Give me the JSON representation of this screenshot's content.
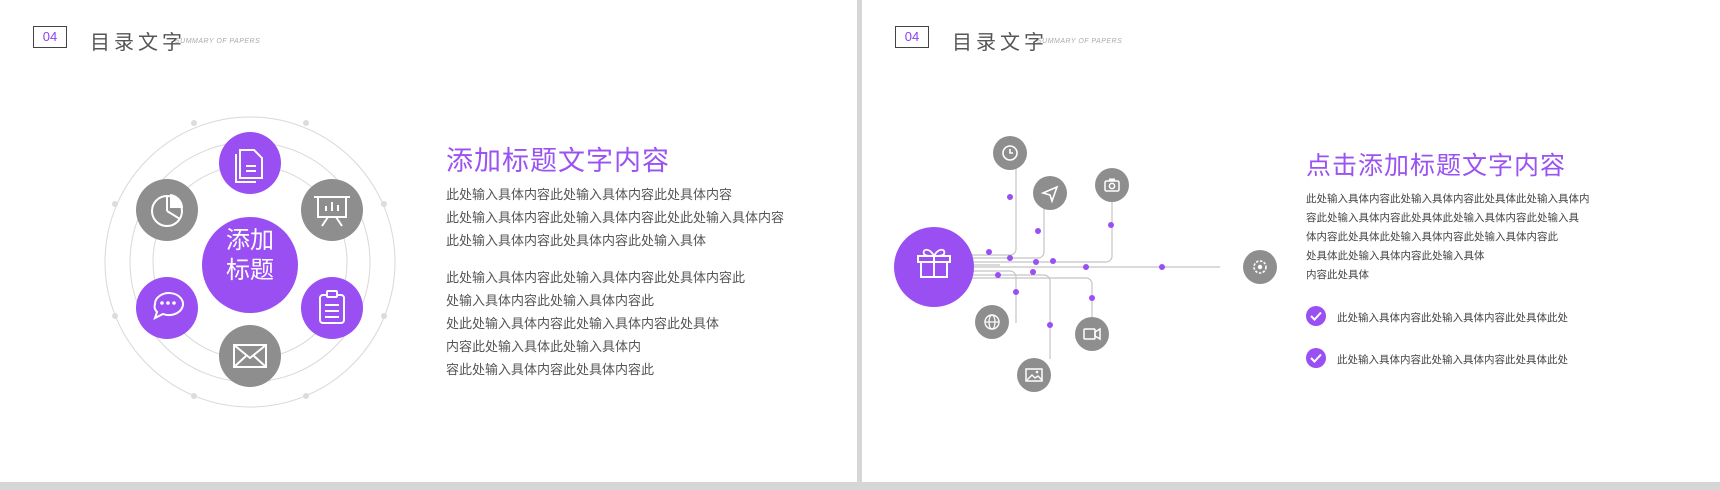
{
  "left": {
    "page_num": "04",
    "header_title": "目录文字",
    "header_sub": "SUMMARY OF PAPERS",
    "center_label_1": "添加",
    "center_label_2": "标题",
    "title": "添加标题文字内容",
    "para1": [
      "此处输入具体内容此处输入具体内容此处具体内容",
      "此处输入具体内容此处输入具体内容此处此处输入具体内容",
      "此处输入具体内容此处具体内容此处输入具体"
    ],
    "para2": [
      "此处输入具体内容此处输入具体内容此处具体内容此",
      "处输入具体内容此处输入具体内容此",
      "处此处输入具体内容此处输入具体内容此处具体",
      "内容此处输入具体此处输入具体内",
      "容此处输入具体内容此处具体内容此"
    ]
  },
  "right": {
    "page_num": "04",
    "header_title": "目录文字",
    "header_sub": "SUMMARY OF PAPERS",
    "title": "点击添加标题文字内容",
    "para": [
      "此处输入具体内容此处输入具体内容此处具体此处输入具体内",
      "容此处输入具体内容此处具体此处输入具体内容此处输入具",
      "体内容此处具体此处输入具体内容此处输入具体内容此",
      "处具体此处输入具体内容此处输入具体",
      "内容此处具体"
    ],
    "check1": "此处输入具体内容此处输入具体内容此处具体此处",
    "check2": "此处输入具体内容此处输入具体内容此处具体此处"
  },
  "colors": {
    "accent": "#9a4ff3",
    "gray": "#8e8e8e"
  }
}
